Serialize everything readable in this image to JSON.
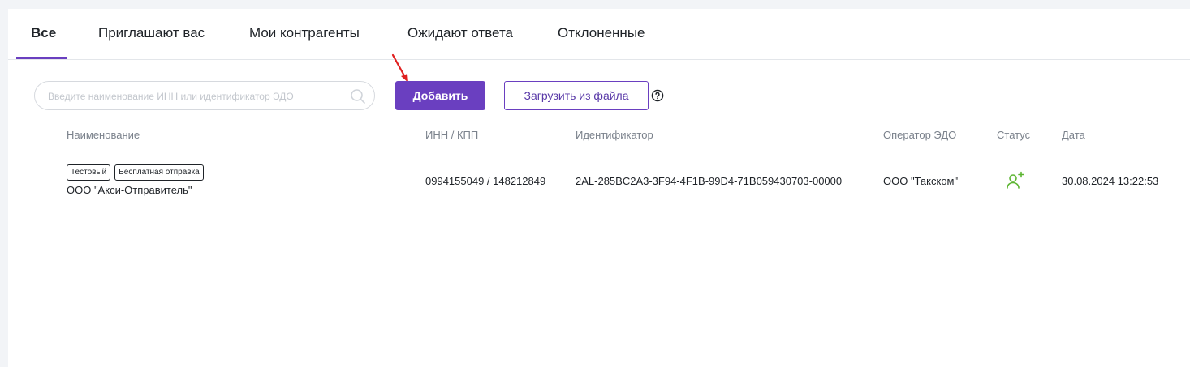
{
  "tabs": [
    {
      "label": "Все",
      "active": true
    },
    {
      "label": "Приглашают вас",
      "active": false
    },
    {
      "label": "Мои контрагенты",
      "active": false
    },
    {
      "label": "Ожидают ответа",
      "active": false
    },
    {
      "label": "Отклоненные",
      "active": false
    }
  ],
  "toolbar": {
    "search_placeholder": "Введите наименование ИНН или идентификатор ЭДО",
    "add_label": "Добавить",
    "upload_label": "Загрузить из файла"
  },
  "table": {
    "columns": [
      "Наименование",
      "ИНН / КПП",
      "Идентификатор",
      "Оператор ЭДО",
      "Статус",
      "Дата"
    ],
    "rows": [
      {
        "tags": [
          "Тестовый",
          "Бесплатная отправка"
        ],
        "name": "ООО \"Акси-Отправитель\"",
        "inn_kpp": "0994155049 / 148212849",
        "identifier": "2AL-285BC2A3-3F94-4F1B-99D4-71B059430703-00000",
        "operator": "ООО \"Такском\"",
        "status_icon": "user-add-icon",
        "date": "30.08.2024 13:22:53"
      }
    ]
  },
  "colors": {
    "accent": "#6a3fc0",
    "status_green": "#5cb531",
    "arrow_red": "#e02020"
  }
}
